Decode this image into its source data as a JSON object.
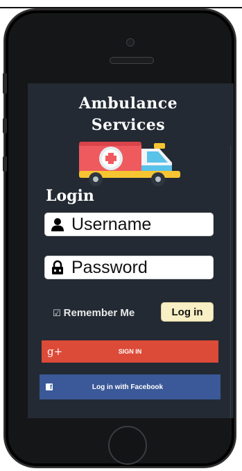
{
  "app": {
    "title_line1": "Ambulance",
    "title_line2": "Services",
    "login_heading": "Login"
  },
  "form": {
    "username_placeholder": "Username",
    "password_placeholder": "Password",
    "remember_label": "Remember Me",
    "login_button": "Log in"
  },
  "social": {
    "google_icon_text": "g+",
    "google_label": "SIGN IN",
    "facebook_icon_text": "f",
    "facebook_label": "Log in with Facebook"
  },
  "icons": {
    "username": "user-icon",
    "password": "lock-icon",
    "remember": "checkbox-icon",
    "hero": "ambulance-icon"
  },
  "colors": {
    "screen_bg": "#232a33",
    "google": "#dc4a38",
    "facebook": "#3b5998",
    "login_button_bg": "#f8efc4"
  }
}
